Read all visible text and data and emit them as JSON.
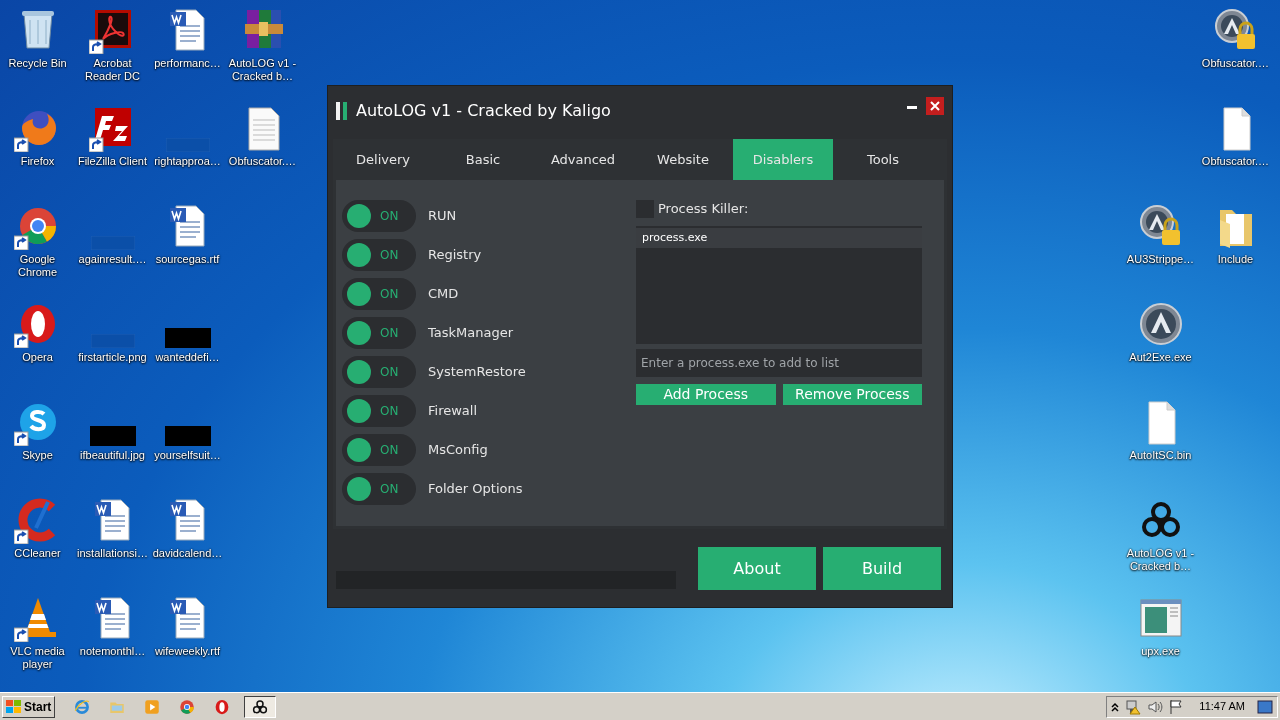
{
  "desktop": {
    "left_columns": [
      [
        {
          "label": "Recycle Bin",
          "kind": "recycle",
          "shortcut": false
        },
        {
          "label": "Firefox",
          "kind": "firefox",
          "shortcut": true
        },
        {
          "label": "Google Chrome",
          "kind": "chrome",
          "shortcut": true
        },
        {
          "label": "Opera",
          "kind": "opera",
          "shortcut": true
        },
        {
          "label": "Skype",
          "kind": "skype",
          "shortcut": true
        },
        {
          "label": "CCleaner",
          "kind": "ccleaner",
          "shortcut": true
        },
        {
          "label": "VLC media player",
          "kind": "vlc",
          "shortcut": true
        }
      ],
      [
        {
          "label": "Acrobat Reader DC",
          "kind": "acrobat",
          "shortcut": true
        },
        {
          "label": "FileZilla Client",
          "kind": "filezilla",
          "shortcut": true
        },
        {
          "label": "againresult.…",
          "kind": "thumb-blue",
          "shortcut": false
        },
        {
          "label": "firstarticle.png",
          "kind": "thumb-blue",
          "shortcut": false
        },
        {
          "label": "ifbeautiful.jpg",
          "kind": "thumb-black",
          "shortcut": false
        },
        {
          "label": "installationsi…",
          "kind": "word",
          "shortcut": false
        },
        {
          "label": "notemonthl…",
          "kind": "word",
          "shortcut": false
        }
      ],
      [
        {
          "label": "performanc…",
          "kind": "word",
          "shortcut": false
        },
        {
          "label": "rightapproa…",
          "kind": "thumb-blue",
          "shortcut": false
        },
        {
          "label": "sourcegas.rtf",
          "kind": "word",
          "shortcut": false
        },
        {
          "label": "wanteddefi…",
          "kind": "thumb-black",
          "shortcut": false
        },
        {
          "label": "yourselfsuit…",
          "kind": "thumb-black",
          "shortcut": false
        },
        {
          "label": "davidcalend…",
          "kind": "word",
          "shortcut": false
        },
        {
          "label": "wifeweekly.rtf",
          "kind": "word",
          "shortcut": false
        }
      ],
      [
        {
          "label": "AutoLOG v1 - Cracked b…",
          "kind": "archive",
          "shortcut": false
        },
        {
          "label": "Obfuscator.…",
          "kind": "textfile",
          "shortcut": false
        }
      ]
    ],
    "right_columns": [
      [
        {
          "label": "AU3Strippe…",
          "kind": "autoit-lock",
          "shortcut": false
        },
        {
          "label": "Aut2Exe.exe",
          "kind": "autoit",
          "shortcut": false
        },
        {
          "label": "AutoItSC.bin",
          "kind": "blankfile",
          "shortcut": false
        },
        {
          "label": "AutoLOG v1 - Cracked b…",
          "kind": "biohazard",
          "shortcut": false
        },
        {
          "label": "upx.exe",
          "kind": "upx",
          "shortcut": false
        }
      ],
      [
        {
          "label": "Obfuscator.…",
          "kind": "autoit-lock",
          "shortcut": false
        },
        {
          "label": "Obfuscator.…",
          "kind": "blankfile",
          "shortcut": false
        },
        {
          "label": "Include",
          "kind": "folder",
          "shortcut": false
        }
      ]
    ]
  },
  "window": {
    "title": "AutoLOG v1 - Cracked by Kaligo",
    "tabs": [
      {
        "label": "Delivery",
        "selected": false
      },
      {
        "label": "Basic",
        "selected": false
      },
      {
        "label": "Advanced",
        "selected": false
      },
      {
        "label": "Website",
        "selected": false
      },
      {
        "label": "Disablers",
        "selected": true
      },
      {
        "label": "Tools",
        "selected": false
      }
    ],
    "toggles": [
      {
        "label": "RUN",
        "on": true,
        "state_text": "ON"
      },
      {
        "label": "Registry",
        "on": true,
        "state_text": "ON"
      },
      {
        "label": "CMD",
        "on": true,
        "state_text": "ON"
      },
      {
        "label": "TaskManager",
        "on": true,
        "state_text": "ON"
      },
      {
        "label": "SystemRestore",
        "on": true,
        "state_text": "ON"
      },
      {
        "label": "Firewall",
        "on": true,
        "state_text": "ON"
      },
      {
        "label": "MsConfig",
        "on": true,
        "state_text": "ON"
      },
      {
        "label": "Folder Options",
        "on": true,
        "state_text": "ON"
      }
    ],
    "process_killer": {
      "label": "Process Killer:",
      "checked": false,
      "list": [
        {
          "text": "process.exe",
          "selected": true
        }
      ],
      "input": {
        "placeholder": "Enter a process.exe to add to list"
      },
      "buttons": [
        "Add Process",
        "Remove Process"
      ]
    },
    "progress": {
      "level": 0
    },
    "buttons": [
      "About",
      "Build"
    ]
  },
  "taskbar": {
    "start": "Start",
    "apps": [
      {
        "kind": "ie",
        "active": false
      },
      {
        "kind": "explorer",
        "active": false
      },
      {
        "kind": "media",
        "active": false
      },
      {
        "kind": "chrome",
        "active": false
      },
      {
        "kind": "opera",
        "active": false
      },
      {
        "kind": "biohazard",
        "active": true
      }
    ],
    "time": "11:47 AM"
  }
}
